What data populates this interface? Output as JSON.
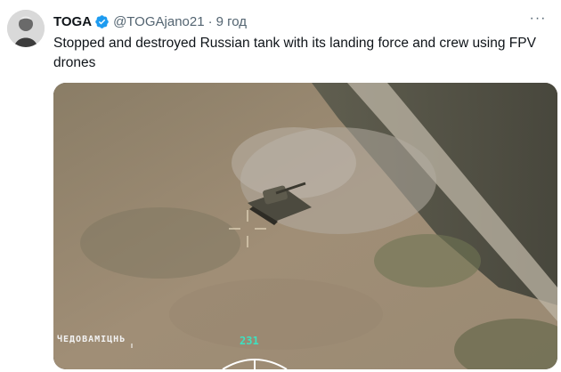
{
  "tweet": {
    "author_name": "TOGA",
    "handle": "@TOGAjano21",
    "separator": "·",
    "time": "9 год",
    "more_label": "···",
    "text": "Stopped and destroyed Russian tank with its landing force and crew using FPV drones"
  },
  "media": {
    "hud_text": "ЧЕДОВАМІЦНЬ",
    "hud_number": "231"
  },
  "colors": {
    "text_primary": "#0f1419",
    "text_secondary": "#536471",
    "verified_badge": "#1d9bf0",
    "hud_accent": "#3fe0c0"
  },
  "icons": [
    "verified-badge-icon",
    "more-options-icon"
  ]
}
